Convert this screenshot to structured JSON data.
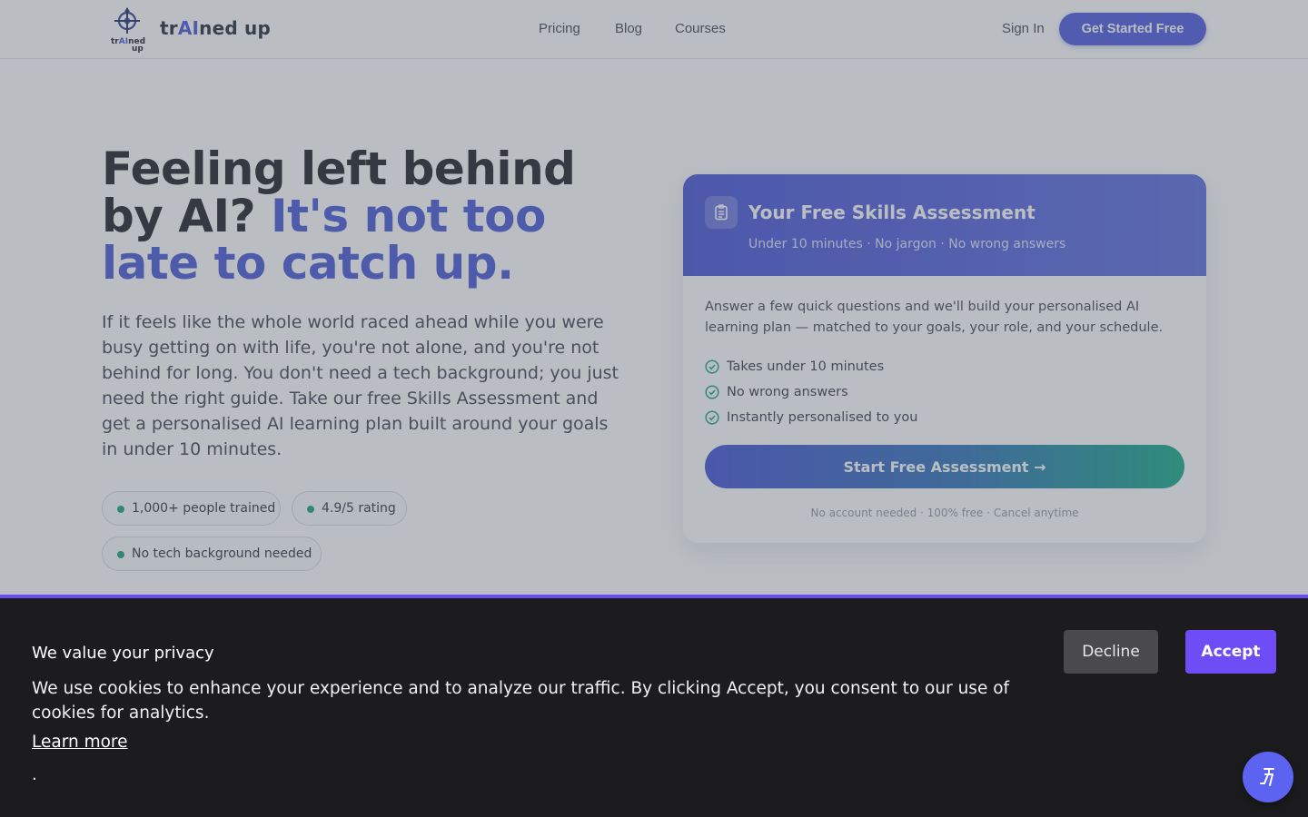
{
  "brand": {
    "name_prefix": "tr",
    "name_ai": "AI",
    "name_suffix": "ned up",
    "logo_text": "trAIned up"
  },
  "nav": {
    "items": [
      "Pricing",
      "Blog",
      "Courses"
    ],
    "sign_in": "Sign In",
    "cta": "Get Started Free"
  },
  "hero": {
    "title_plain": "Feeling left behind by AI? ",
    "title_accent": "It's not too late to catch up.",
    "subtitle": "If it feels like the whole world raced ahead while you were busy getting on with life, you're not alone, and you're not behind for long. You don't need a tech background; you just need the right guide. Take our free Skills Assessment and get a personalised AI learning plan built around your goals in under 10 minutes.",
    "pills": [
      "1,000+ people trained",
      "4.9/5 rating",
      "No tech background needed"
    ]
  },
  "card": {
    "title": "Your Free Skills Assessment",
    "meta": "Under 10 minutes · No jargon · No wrong answers",
    "description": "Answer a few quick questions and we'll build your personalised AI learning plan — matched to your goals, your role, and your schedule.",
    "checks": [
      "Takes under 10 minutes",
      "No wrong answers",
      "Instantly personalised to you"
    ],
    "button": "Start Free Assessment →",
    "footer": "No account needed · 100% free · Cancel anytime"
  },
  "cookie": {
    "title": "We value your privacy",
    "text": "We use cookies to enhance your experience and to analyze our traffic. By clicking Accept, you consent to our use of cookies for analytics.",
    "link": "Learn more",
    "trailing": ".",
    "decline": "Decline",
    "accept": "Accept"
  },
  "colors": {
    "accent": "#4654d6",
    "teal": "#16a37f",
    "cookie_bg": "#1c1c1e",
    "accept": "#6e4cf6"
  },
  "icons": {
    "logo": "compass-logo-icon",
    "card": "clipboard-icon",
    "check": "check-circle-icon",
    "fab": "accessibility-icon"
  }
}
